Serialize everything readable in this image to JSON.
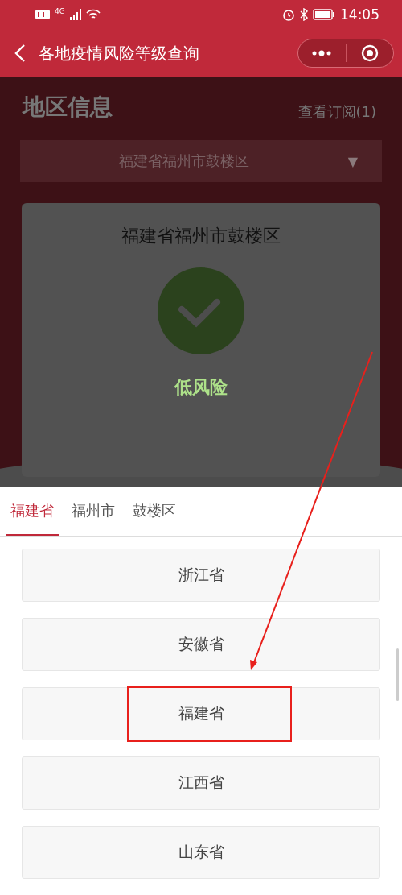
{
  "status_bar": {
    "network": "4G",
    "time": "14:05"
  },
  "nav": {
    "title": "各地疫情风险等级查询"
  },
  "page": {
    "title": "地区信息",
    "subscriptions": "查看订阅(1)",
    "dropdown": {
      "value": "福建省福州市鼓楼区",
      "arrow": "▼"
    },
    "card": {
      "region": "福建省福州市鼓楼区",
      "risk": "低风险"
    }
  },
  "sheet": {
    "tabs": [
      {
        "label": "福建省",
        "selected": true
      },
      {
        "label": "福州市",
        "selected": false
      },
      {
        "label": "鼓楼区",
        "selected": false
      }
    ],
    "options": [
      {
        "label": "浙江省",
        "annotated": false
      },
      {
        "label": "安徽省",
        "annotated": false
      },
      {
        "label": "福建省",
        "annotated": true
      },
      {
        "label": "江西省",
        "annotated": false
      },
      {
        "label": "山东省",
        "annotated": false
      }
    ]
  }
}
